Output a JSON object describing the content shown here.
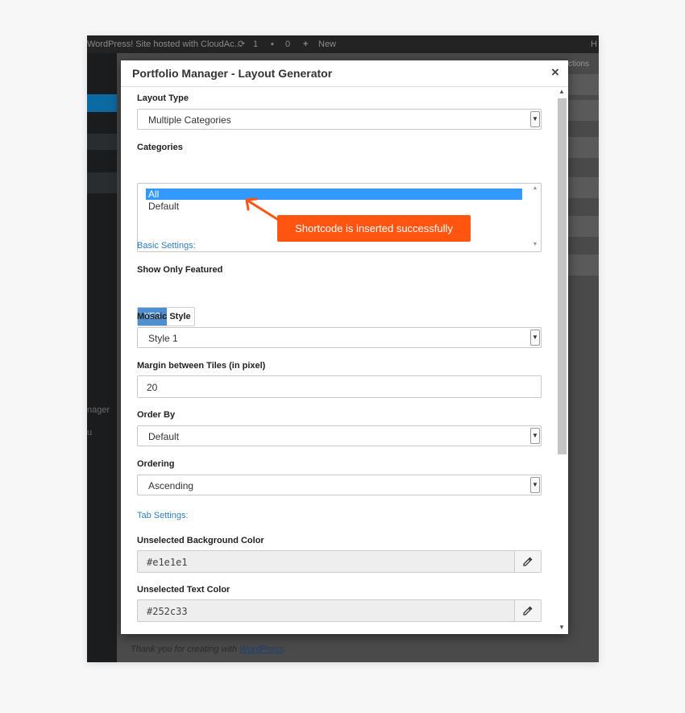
{
  "adminbar": {
    "site_text": "WordPress! Site hosted with CloudAc...",
    "updates_count": "1",
    "comments_count": "0",
    "new_label": "New",
    "howdy_fragment": "H"
  },
  "background": {
    "screen_options_fragment": "ctions",
    "sidebar_fragment_1": "nager",
    "sidebar_fragment_2": "u",
    "footer_prefix": "Thank you for creating with ",
    "footer_link": "WordPress",
    "footer_suffix": "."
  },
  "modal": {
    "title": "Portfolio Manager - Layout Generator",
    "close_symbol": "×",
    "layout_type": {
      "label": "Layout Type",
      "value": "Multiple Categories"
    },
    "categories": {
      "label": "Categories",
      "options": [
        "All",
        "Default"
      ],
      "selected": "All"
    },
    "basic_settings_heading": "Basic Settings:",
    "show_only_featured": {
      "label": "Show Only Featured",
      "toggle_text": "YES"
    },
    "mosaic_style": {
      "label": "Mosaic Style",
      "value": "Style 1"
    },
    "margin_tiles": {
      "label": "Margin between Tiles (in pixel)",
      "value": "20"
    },
    "order_by": {
      "label": "Order By",
      "value": "Default"
    },
    "ordering": {
      "label": "Ordering",
      "value": "Ascending"
    },
    "tab_settings_heading": "Tab Settings:",
    "unselected_bg_color": {
      "label": "Unselected Background Color",
      "value": "#e1e1e1"
    },
    "unselected_text_color": {
      "label": "Unselected Text Color",
      "value": "#252c33"
    }
  },
  "callout": {
    "text": "Shortcode is inserted successfully"
  },
  "colors": {
    "accent_blue": "#2f7fc1",
    "toggle_blue": "#4f8fcf",
    "callout_orange": "#ff5511",
    "selection_blue": "#3399ff"
  }
}
